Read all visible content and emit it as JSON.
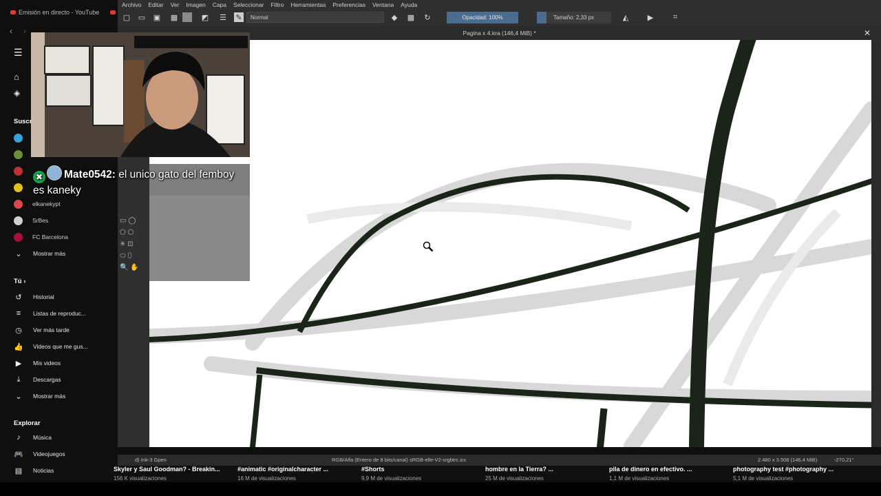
{
  "browser": {
    "tabs": [
      {
        "label": "Emisión en directo - YouTube"
      }
    ]
  },
  "youtube": {
    "subs_section": "Suscri",
    "subscriptions": [
      {
        "name": "elkanekypt",
        "color": "#d94b4b"
      },
      {
        "name": "SrBes",
        "color": "#cfcfcf"
      },
      {
        "name": "FC Barcelona",
        "color": "#a5113b"
      }
    ],
    "subs_more": "Mostrar más",
    "you_section": "Tú",
    "you_items": [
      {
        "label": "Historial",
        "icon": "history-icon"
      },
      {
        "label": "Listas de reproduc...",
        "icon": "playlist-icon"
      },
      {
        "label": "Ver más tarde",
        "icon": "clock-icon"
      },
      {
        "label": "Videos que me gus...",
        "icon": "like-icon"
      },
      {
        "label": "Mis videos",
        "icon": "my-videos-icon"
      },
      {
        "label": "Descargas",
        "icon": "download-icon"
      },
      {
        "label": "Mostrar más",
        "icon": "chevron-down-icon"
      }
    ],
    "explore_section": "Explorar",
    "explore_items": [
      {
        "label": "Música",
        "icon": "music-icon"
      },
      {
        "label": "Videojuegos",
        "icon": "gaming-icon"
      },
      {
        "label": "Noticias",
        "icon": "news-icon"
      }
    ],
    "videos": [
      {
        "title": "Skyler y Saul Goodman? - Breakin...",
        "views": "156 K visualizaciones"
      },
      {
        "title": "#animatic #originalcharacter ...",
        "views": "16 M de visualizaciones"
      },
      {
        "title": "#Shorts",
        "views": "9,9 M de visualizaciones"
      },
      {
        "title": "hombre en la Tierra? ...",
        "views": "25 M de visualizaciones"
      },
      {
        "title": "pila de dinero en efectivo. ...",
        "views": "1,1 M de visualizaciones"
      },
      {
        "title": "photography test #photography ...",
        "views": "5,1 M de visualizaciones"
      }
    ]
  },
  "krita": {
    "menu": [
      "Archivo",
      "Editar",
      "Ver",
      "Imagen",
      "Capa",
      "Seleccionar",
      "Filtro",
      "Herramientas",
      "Preferencias",
      "Ventana",
      "Ayuda"
    ],
    "blend_mode": "Normal",
    "opacity": "Opacidad: 100%",
    "size": "Tamaño: 2,33 px",
    "document_title": "Pagina x 4.kra (146,4 MiB) *",
    "status": {
      "brush": "d) Ink-3 Gpen",
      "color_profile": "RGB/Alfa (Entero de 8 bits/canal)  sRGB-elle-V2-srgbtrc.icc",
      "dimensions": "2.480 x 3.508 (146,4 MiB)",
      "rotation": "-270,21°"
    },
    "accent_color": "#4b6c8f"
  },
  "chat": {
    "username": "Mate0542",
    "message": " el unico gato del femboy es kaneky"
  }
}
